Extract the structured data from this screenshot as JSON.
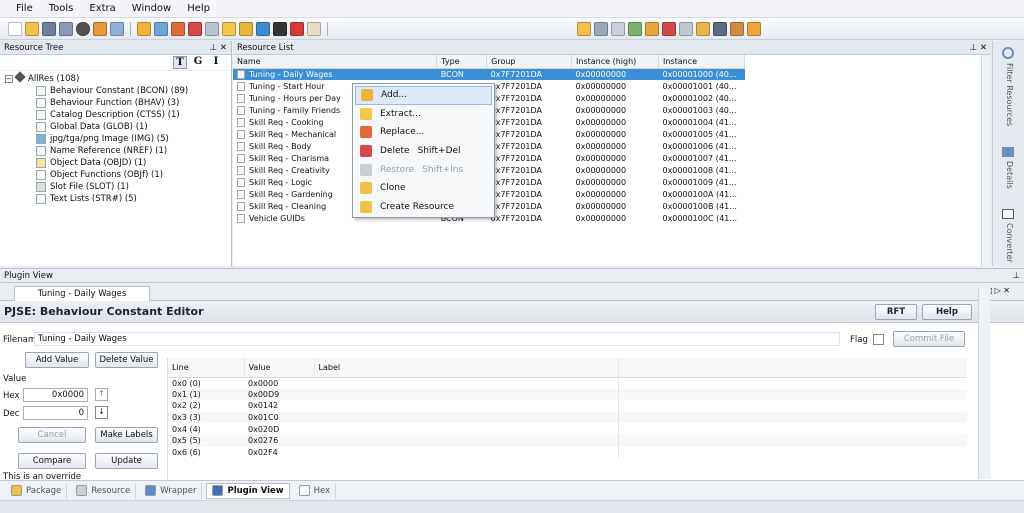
{
  "menu": [
    "File",
    "Tools",
    "Extra",
    "Window",
    "Help"
  ],
  "toolbar_icons": [
    "new-icon",
    "open-icon",
    "save-icon",
    "save-as-icon",
    "close-icon",
    "settings-icon",
    "search-icon",
    "import-icon",
    "export-icon",
    "replace-icon",
    "delete-icon",
    "restore-icon",
    "clone-icon",
    "refresh-icon",
    "edit-icon",
    "cancel-icon",
    "tag-icon",
    "package-icon",
    "hex-icon",
    "list-icon",
    "plugin-icon",
    "grid-icon",
    "cut-icon",
    "copy-icon",
    "paste-icon",
    "find-icon",
    "help-icon"
  ],
  "resource_tree": {
    "title": "Resource Tree",
    "toggles": [
      "T",
      "G",
      "I"
    ],
    "root": "AllRes (108)",
    "items": [
      "Behaviour Constant (BCON) (89)",
      "Behaviour Function (BHAV) (3)",
      "Catalog Description (CTSS) (1)",
      "Global Data (GLOB) (1)",
      "jpg/tga/png Image (IMG) (5)",
      "Name Reference (NREF) (1)",
      "Object Data (OBJD) (1)",
      "Object Functions (OBJf) (1)",
      "Slot File (SLOT) (1)",
      "Text Lists (STR#) (5)"
    ]
  },
  "resource_list": {
    "title": "Resource List",
    "columns": [
      "Name",
      "Type",
      "Group",
      "Instance (high)",
      "Instance"
    ],
    "rows": [
      {
        "name": "Tuning - Daily Wages",
        "type": "BCON",
        "group": "0x7F7201DA",
        "ihigh": "0x00000000",
        "inst": "0x00001000 (40..."
      },
      {
        "name": "Tuning - Start Hour",
        "type": "BCON",
        "group": "0x7F7201DA",
        "ihigh": "0x00000000",
        "inst": "0x00001001 (40..."
      },
      {
        "name": "Tuning - Hours per Day",
        "type": "BCON",
        "group": "0x7F7201DA",
        "ihigh": "0x00000000",
        "inst": "0x00001002 (40..."
      },
      {
        "name": "Tuning - Family Friends",
        "type": "BCON",
        "group": "0x7F7201DA",
        "ihigh": "0x00000000",
        "inst": "0x00001003 (40..."
      },
      {
        "name": "Skill Req - Cooking",
        "type": "BCON",
        "group": "0x7F7201DA",
        "ihigh": "0x00000000",
        "inst": "0x00001004 (41..."
      },
      {
        "name": "Skill Req - Mechanical",
        "type": "BCON",
        "group": "0x7F7201DA",
        "ihigh": "0x00000000",
        "inst": "0x00001005 (41..."
      },
      {
        "name": "Skill Req - Body",
        "type": "BCON",
        "group": "0x7F7201DA",
        "ihigh": "0x00000000",
        "inst": "0x00001006 (41..."
      },
      {
        "name": "Skill Req - Charisma",
        "type": "BCON",
        "group": "0x7F7201DA",
        "ihigh": "0x00000000",
        "inst": "0x00001007 (41..."
      },
      {
        "name": "Skill Req - Creativity",
        "type": "BCON",
        "group": "0x7F7201DA",
        "ihigh": "0x00000000",
        "inst": "0x00001008 (41..."
      },
      {
        "name": "Skill Req - Logic",
        "type": "BCON",
        "group": "0x7F7201DA",
        "ihigh": "0x00000000",
        "inst": "0x00001009 (41..."
      },
      {
        "name": "Skill Req - Gardening",
        "type": "BCON",
        "group": "0x7F7201DA",
        "ihigh": "0x00000000",
        "inst": "0x0000100A (41..."
      },
      {
        "name": "Skill Req - Cleaning",
        "type": "BCON",
        "group": "0x7F7201DA",
        "ihigh": "0x00000000",
        "inst": "0x0000100B (41..."
      },
      {
        "name": "Vehicle GUIDs",
        "type": "BCON",
        "group": "0x7F7201DA",
        "ihigh": "0x00000000",
        "inst": "0x0000100C (41..."
      }
    ]
  },
  "side_tabs": [
    "Filter Resources",
    "Details",
    "Converter"
  ],
  "context_menu": [
    {
      "label": "Add...",
      "shortcut": "",
      "state": "highlight"
    },
    {
      "label": "Extract...",
      "shortcut": "",
      "state": "normal"
    },
    {
      "label": "Replace...",
      "shortcut": "",
      "state": "normal"
    },
    {
      "label": "Delete",
      "shortcut": "Shift+Del",
      "state": "normal"
    },
    {
      "label": "Restore",
      "shortcut": "Shift+Ins",
      "state": "disabled"
    },
    {
      "label": "Clone",
      "shortcut": "",
      "state": "normal"
    },
    {
      "label": "Create Resource",
      "shortcut": "",
      "state": "normal"
    }
  ],
  "plugin": {
    "title": "Plugin View",
    "tab": "Tuning - Daily Wages",
    "editor_title": "PJSE: Behaviour Constant Editor",
    "rft": "RFT",
    "help": "Help",
    "filename_label": "Filename",
    "filename": "Tuning - Daily Wages",
    "flag_label": "Flag",
    "commit": "Commit File",
    "add_value": "Add Value",
    "delete_value": "Delete Value",
    "value_label": "Value",
    "hex_label": "Hex",
    "hex_value": "0x0000",
    "dec_label": "Dec",
    "dec_value": "0",
    "cancel": "Cancel",
    "make_labels": "Make Labels",
    "compare": "Compare",
    "update": "Update",
    "override_note": "This is an override",
    "columns": [
      "Line",
      "Value",
      "Label"
    ],
    "rows": [
      {
        "line": "0x0 (0)",
        "value": "0x0000"
      },
      {
        "line": "0x1 (1)",
        "value": "0x00D9"
      },
      {
        "line": "0x2 (2)",
        "value": "0x0142"
      },
      {
        "line": "0x3 (3)",
        "value": "0x01C0"
      },
      {
        "line": "0x4 (4)",
        "value": "0x020D"
      },
      {
        "line": "0x5 (5)",
        "value": "0x0276"
      },
      {
        "line": "0x6 (6)",
        "value": "0x02F4"
      }
    ]
  },
  "bottom_tabs": [
    {
      "label": "Package",
      "icon": "package-icon",
      "active": false
    },
    {
      "label": "Resource",
      "icon": "resource-icon",
      "active": false
    },
    {
      "label": "Wrapper",
      "icon": "wrapper-icon",
      "active": false
    },
    {
      "label": "Plugin View",
      "icon": "plugin-icon",
      "active": true
    },
    {
      "label": "Hex",
      "icon": "hex-icon",
      "active": false
    }
  ]
}
